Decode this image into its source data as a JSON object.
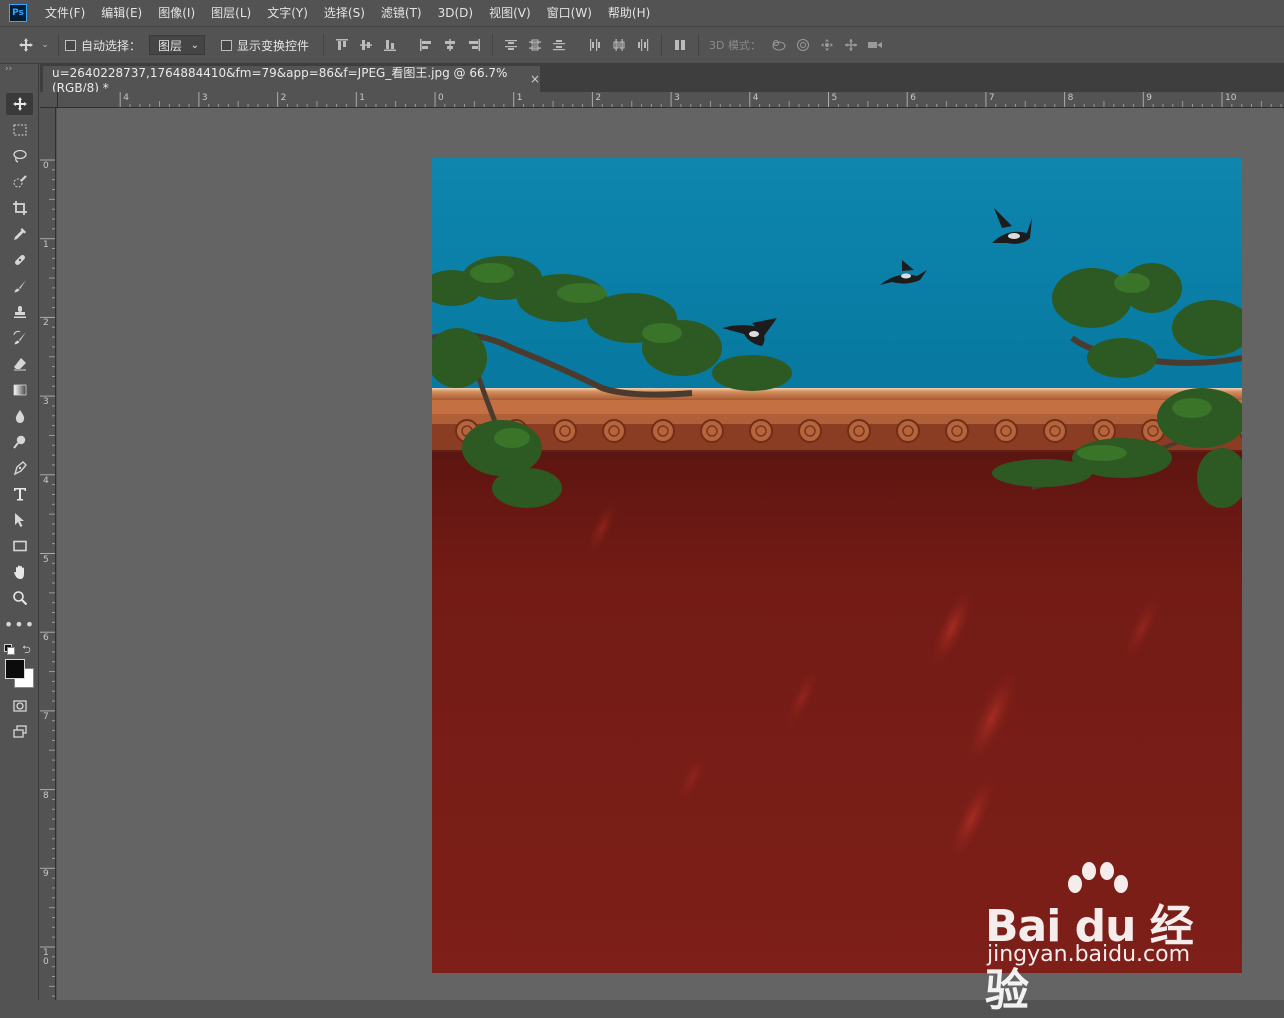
{
  "app": {
    "logo": "Ps"
  },
  "menu": [
    "文件(F)",
    "编辑(E)",
    "图像(I)",
    "图层(L)",
    "文字(Y)",
    "选择(S)",
    "滤镜(T)",
    "3D(D)",
    "视图(V)",
    "窗口(W)",
    "帮助(H)"
  ],
  "options": {
    "auto_select_label": "自动选择：",
    "auto_select_value": "图层",
    "show_transform_label": "显示变换控件",
    "mode_3d_label": "3D 模式："
  },
  "document": {
    "tab_title": "u=2640228737,1764884410&fm=79&app=86&f=JPEG_看图王.jpg @ 66.7%(RGB/8) *",
    "close_glyph": "×"
  },
  "ruler": {
    "top_labels": [
      "4",
      "3",
      "2",
      "1",
      "0",
      "1",
      "2",
      "3",
      "4",
      "5",
      "6",
      "7",
      "8",
      "9",
      "10"
    ],
    "left_labels": [
      "0",
      "1",
      "2",
      "3",
      "4",
      "5",
      "6",
      "7",
      "8",
      "9",
      "1\n0"
    ]
  },
  "watermark": {
    "brand": "Bai du 经验",
    "url": "jingyan.baidu.com"
  },
  "colors": {
    "sky": "#0a7fa7",
    "wall": "#7a1e18",
    "roof": "#c87a48",
    "pine": "#2f5a22"
  }
}
